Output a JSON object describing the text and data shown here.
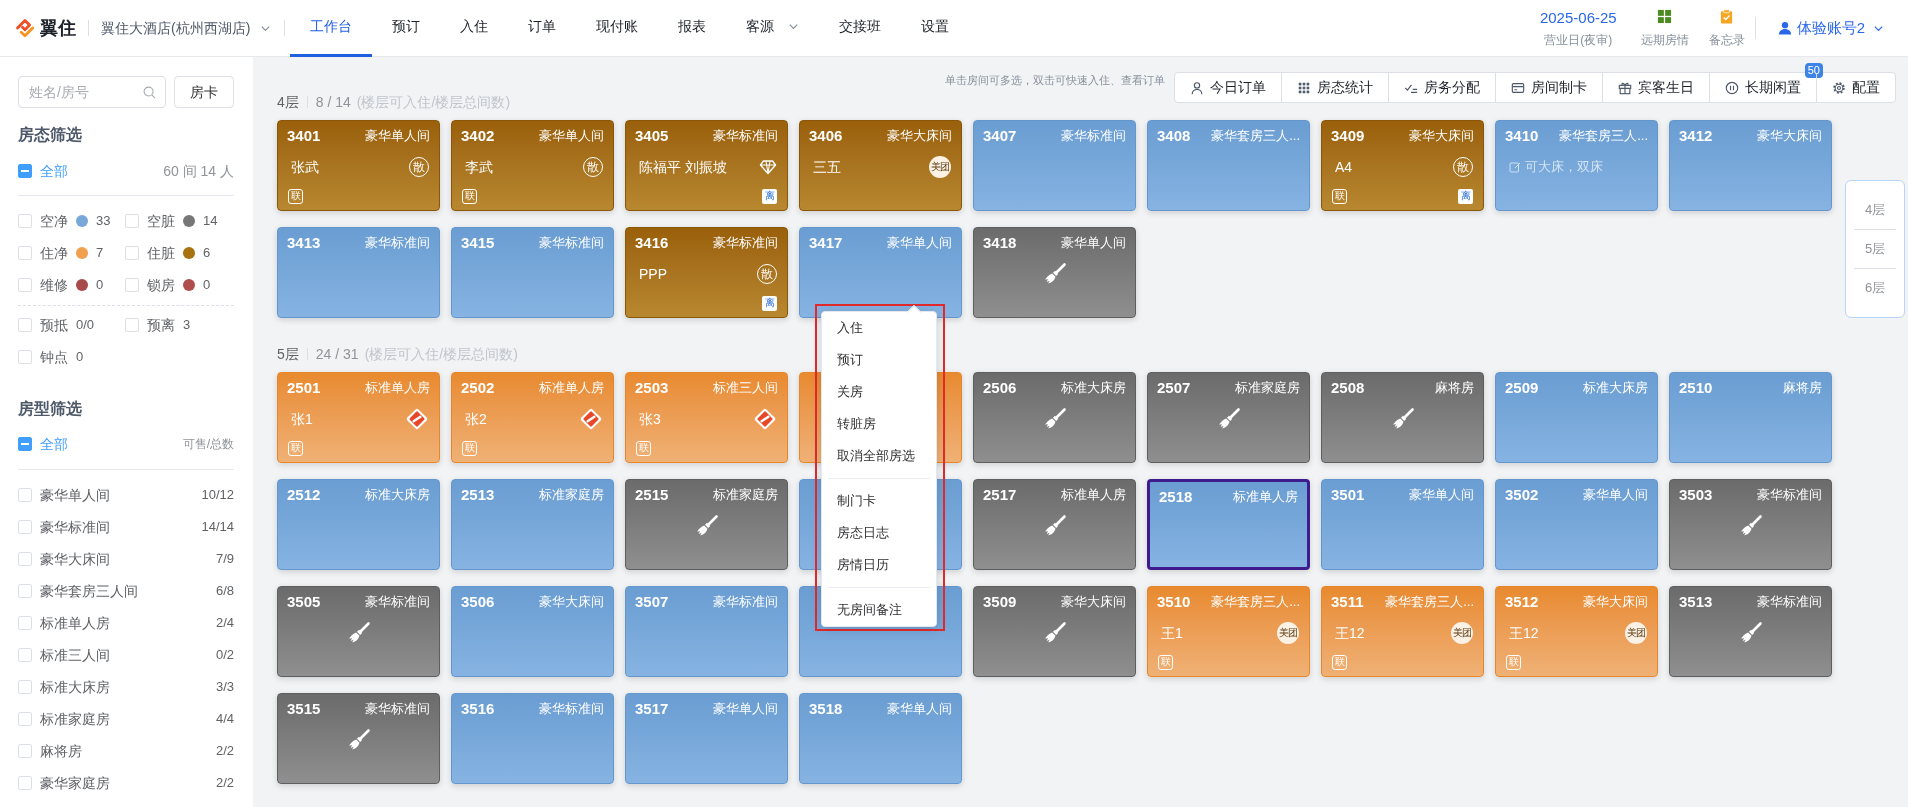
{
  "header": {
    "brand": "翼住",
    "hotel": "翼住大酒店(杭州西湖店)",
    "nav": [
      {
        "label": "工作台",
        "selected": true,
        "dropdown": false
      },
      {
        "label": "预订",
        "selected": false,
        "dropdown": false
      },
      {
        "label": "入住",
        "selected": false,
        "dropdown": false
      },
      {
        "label": "订单",
        "selected": false,
        "dropdown": false
      },
      {
        "label": "现付账",
        "selected": false,
        "dropdown": false
      },
      {
        "label": "报表",
        "selected": false,
        "dropdown": false
      },
      {
        "label": "客源",
        "selected": false,
        "dropdown": true
      },
      {
        "label": "交接班",
        "selected": false,
        "dropdown": false
      },
      {
        "label": "设置",
        "selected": false,
        "dropdown": false
      }
    ],
    "date": "2025-06-25",
    "date_caption": "营业日(夜审)",
    "shortcuts": [
      {
        "kind": "calendar",
        "label": "远期房情"
      },
      {
        "kind": "memo",
        "label": "备忘录"
      }
    ],
    "user": "体验账号2"
  },
  "sidebar": {
    "search": {
      "placeholder": "姓名/房号"
    },
    "card_button": "房卡",
    "status_filter": {
      "title": "房态筛选",
      "all": {
        "label": "全部",
        "mixed": true,
        "summary": "60 间 14 人"
      },
      "items": [
        {
          "label": "空净",
          "checked": false,
          "color": "#78a7da",
          "count": "33"
        },
        {
          "label": "空脏",
          "checked": false,
          "color": "#777777",
          "count": "14"
        },
        {
          "label": "住净",
          "checked": false,
          "color": "#f0a04e",
          "count": "7"
        },
        {
          "label": "住脏",
          "checked": false,
          "color": "#a8720f",
          "count": "6"
        },
        {
          "label": "维修",
          "checked": false,
          "color": "#a84a4a",
          "count": "0"
        },
        {
          "label": "锁房",
          "checked": false,
          "color": "#b04e4e",
          "count": "0"
        }
      ],
      "extras": [
        {
          "label": "预抵",
          "checked": false,
          "count": "0/0"
        },
        {
          "label": "预离",
          "checked": false,
          "count": "3"
        },
        {
          "label": "钟点",
          "checked": false,
          "count": "0"
        }
      ]
    },
    "type_filter": {
      "title": "房型筛选",
      "all": {
        "label": "全部",
        "mixed": true,
        "summary": "可售/总数"
      },
      "items": [
        {
          "label": "豪华单人间",
          "checked": false,
          "count": "10/12"
        },
        {
          "label": "豪华标准间",
          "checked": false,
          "count": "14/14"
        },
        {
          "label": "豪华大床间",
          "checked": false,
          "count": "7/9"
        },
        {
          "label": "豪华套房三人间",
          "checked": false,
          "count": "6/8"
        },
        {
          "label": "标准单人房",
          "checked": false,
          "count": "2/4"
        },
        {
          "label": "标准三人间",
          "checked": false,
          "count": "0/2"
        },
        {
          "label": "标准大床房",
          "checked": false,
          "count": "3/3"
        },
        {
          "label": "标准家庭房",
          "checked": false,
          "count": "4/4"
        },
        {
          "label": "麻将房",
          "checked": false,
          "count": "2/2"
        },
        {
          "label": "豪华家庭房",
          "checked": false,
          "count": "2/2"
        }
      ]
    }
  },
  "toolbar": {
    "hint": "单击房间可多选，双击可快速入住、查看订单",
    "buttons": [
      {
        "kind": "person",
        "label": "今日订单"
      },
      {
        "kind": "grid",
        "label": "房态统计"
      },
      {
        "kind": "checklist",
        "label": "房务分配"
      },
      {
        "kind": "card",
        "label": "房间制卡"
      },
      {
        "kind": "gift",
        "label": "宾客生日"
      },
      {
        "kind": "pause",
        "label": "长期闲置",
        "badge": "50"
      },
      {
        "kind": "gear",
        "label": "配置"
      }
    ]
  },
  "floors": [
    {
      "label": "4层",
      "count": "8 / 14",
      "note": "(楼层可入住/楼层总间数)",
      "rooms": [
        {
          "number": "3401",
          "type": "豪华单人间",
          "occupied": true,
          "dirty": true,
          "guest": "张武",
          "source": {
            "kind": "walk_in",
            "label": "散"
          },
          "link_tag": "联",
          "selected": false
        },
        {
          "number": "3402",
          "type": "豪华单人间",
          "occupied": true,
          "dirty": true,
          "guest": "李武",
          "source": {
            "kind": "walk_in",
            "label": "散"
          },
          "link_tag": "联",
          "selected": false
        },
        {
          "number": "3405",
          "type": "豪华标准间",
          "occupied": true,
          "dirty": true,
          "guest": "陈福平 刘振坡",
          "source": {
            "kind": "gem"
          },
          "departure_tag": "离",
          "selected": false
        },
        {
          "number": "3406",
          "type": "豪华大床间",
          "occupied": true,
          "dirty": true,
          "guest": "三五",
          "source": {
            "kind": "meituan",
            "label": "美团"
          },
          "selected": false
        },
        {
          "number": "3407",
          "type": "豪华标准间",
          "occupied": false,
          "dirty": false,
          "selected": false
        },
        {
          "number": "3408",
          "type": "豪华套房三人...",
          "occupied": false,
          "dirty": false,
          "selected": false
        },
        {
          "number": "3409",
          "type": "豪华大床间",
          "occupied": true,
          "dirty": true,
          "guest": "A4",
          "source": {
            "kind": "walk_in",
            "label": "散"
          },
          "link_tag": "联",
          "departure_tag": "离",
          "selected": false
        },
        {
          "number": "3410",
          "type": "豪华套房三人...",
          "occupied": false,
          "dirty": false,
          "note": "可大床，双床",
          "selected": false
        },
        {
          "number": "3412",
          "type": "豪华大床间",
          "occupied": false,
          "dirty": false,
          "selected": false
        },
        {
          "number": "3413",
          "type": "豪华标准间",
          "occupied": false,
          "dirty": false,
          "selected": false
        },
        {
          "number": "3415",
          "type": "豪华标准间",
          "occupied": false,
          "dirty": false,
          "selected": false
        },
        {
          "number": "3416",
          "type": "豪华标准间",
          "occupied": true,
          "dirty": true,
          "guest": "PPP",
          "source": {
            "kind": "walk_in",
            "label": "散"
          },
          "departure_tag": "离",
          "selected": false
        },
        {
          "number": "3417",
          "type": "豪华单人间",
          "occupied": false,
          "dirty": false,
          "selected": false
        },
        {
          "number": "3418",
          "type": "豪华单人间",
          "occupied": false,
          "dirty": true,
          "selected": false
        }
      ]
    },
    {
      "label": "5层",
      "count": "24 / 31",
      "note": "(楼层可入住/楼层总间数)",
      "rooms": [
        {
          "number": "2501",
          "type": "标准单人房",
          "occupied": true,
          "dirty": false,
          "guest": "张1",
          "source": {
            "kind": "logo"
          },
          "link_tag": "联",
          "selected": false
        },
        {
          "number": "2502",
          "type": "标准单人房",
          "occupied": true,
          "dirty": false,
          "guest": "张2",
          "source": {
            "kind": "logo"
          },
          "link_tag": "联",
          "selected": false
        },
        {
          "number": "2503",
          "type": "标准三人间",
          "occupied": true,
          "dirty": false,
          "guest": "张3",
          "source": {
            "kind": "logo"
          },
          "link_tag": "联",
          "selected": false
        },
        {
          "occupied": true,
          "dirty": false,
          "selected": false
        },
        {
          "number": "2506",
          "type": "标准大床房",
          "occupied": false,
          "dirty": true,
          "selected": false
        },
        {
          "number": "2507",
          "type": "标准家庭房",
          "occupied": false,
          "dirty": true,
          "selected": false
        },
        {
          "number": "2508",
          "type": "麻将房",
          "occupied": false,
          "dirty": true,
          "selected": false
        },
        {
          "number": "2509",
          "type": "标准大床房",
          "occupied": false,
          "dirty": false,
          "selected": false
        },
        {
          "number": "2510",
          "type": "麻将房",
          "occupied": false,
          "dirty": false,
          "selected": false
        },
        {
          "number": "2512",
          "type": "标准大床房",
          "occupied": false,
          "dirty": false,
          "selected": false
        },
        {
          "number": "2513",
          "type": "标准家庭房",
          "occupied": false,
          "dirty": false,
          "selected": false
        },
        {
          "number": "2515",
          "type": "标准家庭房",
          "occupied": false,
          "dirty": true,
          "selected": false
        },
        {
          "occupied": false,
          "dirty": false,
          "selected": false
        },
        {
          "number": "2517",
          "type": "标准单人房",
          "occupied": false,
          "dirty": true,
          "selected": false
        },
        {
          "number": "2518",
          "type": "标准单人房",
          "occupied": false,
          "dirty": false,
          "selected": true
        },
        {
          "number": "3501",
          "type": "豪华单人间",
          "occupied": false,
          "dirty": false,
          "selected": false
        },
        {
          "number": "3502",
          "type": "豪华单人间",
          "occupied": false,
          "dirty": false,
          "selected": false
        },
        {
          "number": "3503",
          "type": "豪华标准间",
          "occupied": false,
          "dirty": true,
          "selected": false
        },
        {
          "number": "3505",
          "type": "豪华标准间",
          "occupied": false,
          "dirty": true,
          "selected": false
        },
        {
          "number": "3506",
          "type": "豪华大床间",
          "occupied": false,
          "dirty": false,
          "selected": false
        },
        {
          "number": "3507",
          "type": "豪华标准间",
          "occupied": false,
          "dirty": false,
          "selected": false
        },
        {
          "occupied": false,
          "dirty": false,
          "selected": false
        },
        {
          "number": "3509",
          "type": "豪华大床间",
          "occupied": false,
          "dirty": true,
          "selected": false
        },
        {
          "number": "3510",
          "type": "豪华套房三人...",
          "occupied": true,
          "dirty": false,
          "guest": "王1",
          "source": {
            "kind": "meituan",
            "label": "美团"
          },
          "link_tag": "联",
          "selected": false
        },
        {
          "number": "3511",
          "type": "豪华套房三人...",
          "occupied": true,
          "dirty": false,
          "guest": "王12",
          "source": {
            "kind": "meituan",
            "label": "美团"
          },
          "link_tag": "联",
          "selected": false
        },
        {
          "number": "3512",
          "type": "豪华大床间",
          "occupied": true,
          "dirty": false,
          "guest": "王12",
          "source": {
            "kind": "meituan",
            "label": "美团"
          },
          "link_tag": "联",
          "selected": false
        },
        {
          "number": "3513",
          "type": "豪华标准间",
          "occupied": false,
          "dirty": true,
          "selected": false
        },
        {
          "number": "3515",
          "type": "豪华标准间",
          "occupied": false,
          "dirty": true,
          "selected": false
        },
        {
          "number": "3516",
          "type": "豪华标准间",
          "occupied": false,
          "dirty": false,
          "selected": false
        },
        {
          "number": "3517",
          "type": "豪华单人间",
          "occupied": false,
          "dirty": false,
          "selected": false
        },
        {
          "number": "3518",
          "type": "豪华单人间",
          "occupied": false,
          "dirty": false,
          "selected": false
        }
      ]
    }
  ],
  "floor_nav": [
    "4层",
    "5层",
    "6层"
  ],
  "context_menu": {
    "groups": [
      [
        "入住",
        "预订",
        "关房",
        "转脏房",
        "取消全部房选"
      ],
      [
        "制门卡",
        "房态日志",
        "房情日历"
      ],
      [
        "无房间备注"
      ]
    ]
  }
}
